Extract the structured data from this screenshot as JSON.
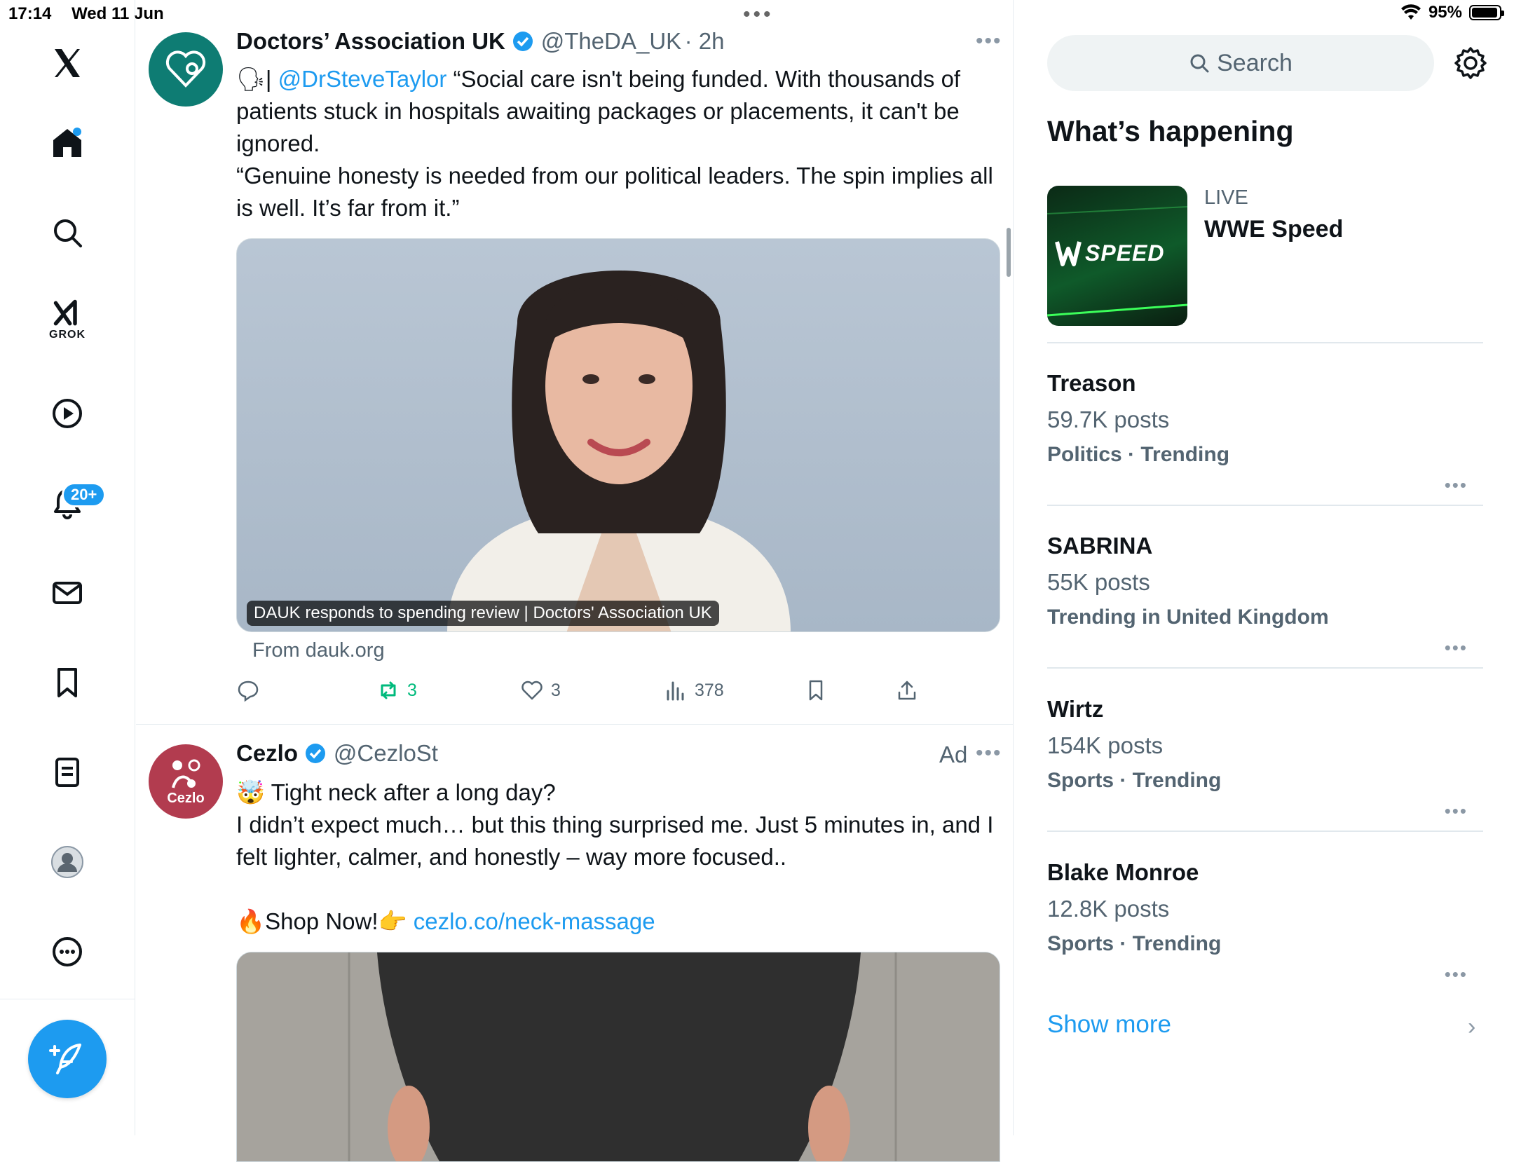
{
  "status": {
    "time": "17:14",
    "date": "Wed 11 Jun",
    "battery": "95%",
    "battery_level": 0.95
  },
  "nav": {
    "grok_label": "GROK",
    "notifications_badge": "20+"
  },
  "feed": {
    "tweets": [
      {
        "name": "Doctors’ Association UK",
        "handle": "@TheDA_UK",
        "time": "· 2h",
        "mention": "@DrSteveTaylor",
        "text_1": "“Social care isn't being funded. With thousands of patients stuck in hospitals awaiting packages or placements, it can't be ignored.",
        "text_2": "“Genuine honesty is needed from our political leaders. The spin implies all is well. It’s far from it.”",
        "card_caption": "DAUK responds to spending review | Doctors' Association UK",
        "card_source": "From dauk.org",
        "retweets": "3",
        "likes": "3",
        "views": "378"
      },
      {
        "name": "Cezlo",
        "handle": "@CezloSt",
        "ad_label": "Ad",
        "avatar_label": "Cezlo",
        "line_1": "Tight neck after a long day?",
        "line_2": "I didn’t expect much… but this thing surprised me. Just 5 minutes in, and I felt lighter, calmer, and honestly – way more focused..",
        "shop_text": "Shop Now!",
        "link": "cezlo.co/neck-massage"
      }
    ]
  },
  "right": {
    "search_placeholder": "Search",
    "section_title": "What’s happening",
    "live": {
      "label": "LIVE",
      "title": "WWE Speed",
      "thumb_text": "SPEED"
    },
    "trends": [
      {
        "title": "Treason",
        "count": "59.7K posts",
        "category": "Politics · Trending"
      },
      {
        "title": "SABRINA",
        "count": "55K posts",
        "category": "Trending in United Kingdom"
      },
      {
        "title": "Wirtz",
        "count": "154K posts",
        "category": "Sports · Trending"
      },
      {
        "title": "Blake Monroe",
        "count": "12.8K posts",
        "category": "Sports · Trending"
      }
    ],
    "show_more": "Show more"
  },
  "colors": {
    "accent": "#1d9bf0",
    "retweet_green": "#00ba7c",
    "dauk_teal": "#0e7c73",
    "cezlo_red": "#b23c4f"
  }
}
